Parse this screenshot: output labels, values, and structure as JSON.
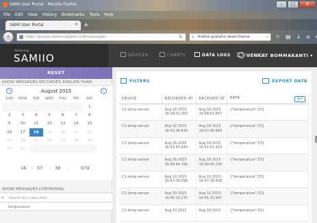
{
  "browser": {
    "title": "SAMI User Portal - Mozilla Firefox",
    "menu": [
      "File",
      "Edit",
      "View",
      "History",
      "Bookmarks",
      "Tools",
      "Help"
    ],
    "tab_label": "SAMI User Portal",
    "url": "https://portal.samsungsami.io/#/messages",
    "search_query": "firefox grateful dead theme",
    "window_buttons": [
      "–",
      "□",
      "✕"
    ]
  },
  "header": {
    "brand_small": "Samsung",
    "brand_big": "SAMIIO",
    "nav": [
      "DEVICES",
      "CHARTS",
      "DATA LOGS",
      "EXPORTS"
    ],
    "user": "VENKAT BOMMAKANTI"
  },
  "sidebar": {
    "reset_label": "RESET",
    "earlier_heading": "SHOW MESSAGES RECORDED EARLIER THAN",
    "calendar": {
      "title": "August 2015",
      "dow": [
        "SUN",
        "MON",
        "TUE",
        "WED",
        "THU",
        "FRI",
        "SAT"
      ],
      "weeks": [
        [
          "",
          "",
          "",
          "",
          "",
          "",
          "1"
        ],
        [
          "2",
          "3",
          "4",
          "5",
          "6",
          "7",
          "8"
        ],
        [
          "9",
          "10",
          "11",
          "12",
          "13",
          "14",
          "15"
        ],
        [
          "16",
          "17",
          "18",
          "19",
          "20",
          "21",
          "22"
        ],
        [
          "23",
          "24",
          "25",
          "26",
          "27",
          "28",
          "29"
        ],
        [
          "30",
          "31",
          "",
          "",
          "",
          "",
          ""
        ]
      ],
      "selected": "18"
    },
    "time": {
      "hour": "16",
      "minute": "57",
      "second": "38",
      "ms": "979"
    },
    "contains_heading": "SHOW MESSAGES CONTAINING",
    "search_placeholder": "Search for a data field",
    "field_tag": "temperature"
  },
  "main": {
    "filters_label": "FILTERS",
    "export_label": "EXPORT DATA",
    "columns": [
      "DEVICE",
      "RECORDED AT",
      "RECEIVED AT",
      "DATA"
    ],
    "rows": [
      {
        "device": "C1-temp-sensor",
        "recorded": [
          "Aug 18 2015",
          "16:58:01.203"
        ],
        "received": [
          "Aug 18 2015",
          "16:58:01.847"
        ],
        "data": "{\"temperature\":33}"
      },
      {
        "device": "C1-temp-sensor",
        "recorded": [
          "Aug 18 2015",
          "16:53:36.429"
        ],
        "received": [
          "Aug 18 2015",
          "16:53:36.889"
        ],
        "data": "{\"temperature\":33}"
      },
      {
        "device": "C1-temp-sensor",
        "recorded": [
          "Aug 18 2015",
          "16:51:50.643"
        ],
        "received": [
          "Aug 18 2015",
          "16:51:51.123"
        ],
        "data": "{\"temperature\":33}"
      },
      {
        "device": "C1-temp-sensor",
        "recorded": [
          "Aug 18 2015",
          "16:49:44.769"
        ],
        "received": [
          "Aug 18 2015",
          "16:49:45.234"
        ],
        "data": "{\"temperature\":33}"
      },
      {
        "device": "C1-temp-sensor",
        "recorded": [
          "Aug 10 2015",
          "16:47:38.996"
        ],
        "received": [
          "Aug 10 2015",
          "16:47:39.458"
        ],
        "data": "{\"temperature\":33}"
      },
      {
        "device": "C1-temp-sensor",
        "recorded": [
          "Aug 10 2015",
          "16:45:33.170"
        ],
        "received": [
          "Aug 10 2015",
          "16:45:33.587"
        ],
        "data": "{\"temperature\":33}"
      },
      {
        "device": "C1-temp-sensor",
        "recorded": [
          "Aug 10 2015",
          ""
        ],
        "received": [
          "Aug 10 2015",
          ""
        ],
        "data": "{\"temperature\":32}"
      }
    ]
  },
  "colors": {
    "accent": "#2e8fc3",
    "reset_bar": "#8f86c4",
    "header_bg": "#3a3b3d",
    "calendar_selected": "#3a84c4"
  }
}
